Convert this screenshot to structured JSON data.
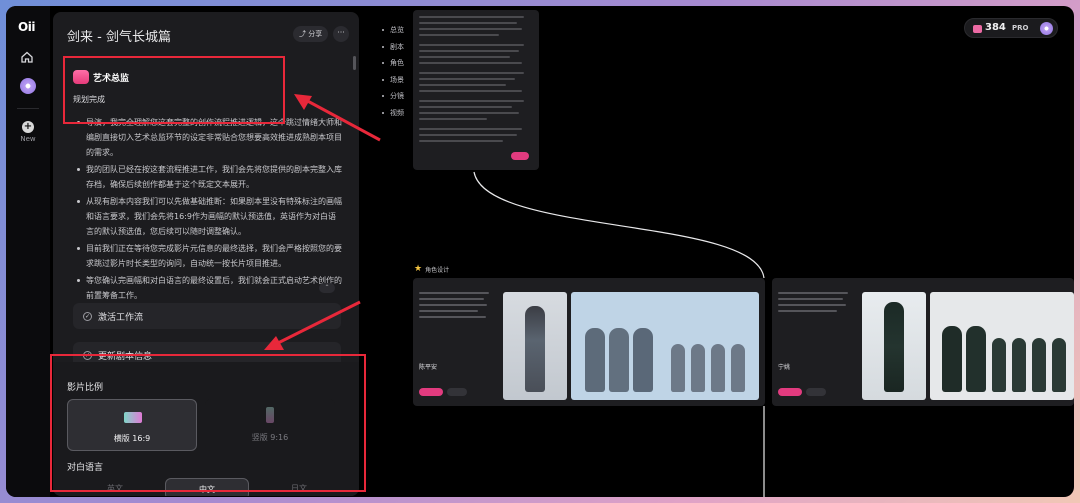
{
  "app": {
    "logo": "Oii",
    "new_label": "New"
  },
  "panel": {
    "title": "剑来 - 剑气长城篇",
    "share_label": "分享",
    "more_label": "···",
    "agent_name": "艺术总监",
    "agent_status": "规划完成",
    "bullets": [
      "导演，我完全理解您这套完整的创作流程推进逻辑，这个跳过情绪大师和编剧直接切入艺术总监环节的设定非常贴合您想要高效推进成熟剧本项目的需求。",
      "我的团队已经在按这套流程推进工作，我们会先将您提供的剧本完整入库存档，确保后续创作都基于这个既定文本展开。",
      "从现有剧本内容我们可以先做基础推断：如果剧本里没有特殊标注的画幅和语言要求，我们会先将16:9作为画幅的默认预选值，英语作为对白语言的默认预选值，您后续可以随时调整确认。",
      "目前我们正在等待您完成影片元信息的最终选择，我们会严格按照您的要求跳过影片时长类型的询问，自动统一按长片项目推进。",
      "等您确认完画幅和对白语言的最终设置后，我们就会正式启动艺术创作的前置筹备工作。"
    ],
    "tasks": [
      "激活工作流",
      "更新剧本信息"
    ],
    "settings": {
      "ratio_label": "影片比例",
      "ratio_options": [
        "横版 16:9",
        "竖版 9:16"
      ],
      "selected_ratio": "横版 16:9",
      "language_label": "对白语言",
      "language_options": [
        "英文",
        "中文",
        "日文"
      ],
      "selected_language": "中文"
    }
  },
  "canvas": {
    "toc": [
      "总览",
      "剧本",
      "角色",
      "场景",
      "分镜",
      "视频"
    ],
    "credits": "384",
    "plan": "PRO",
    "group_label": "角色设计",
    "characters": [
      {
        "name": "陈平安"
      },
      {
        "name": "宁姚"
      }
    ]
  },
  "colors": {
    "accent": "#e23b7f",
    "annotation": "#e8283a",
    "panel_bg": "#1c1c1f"
  }
}
